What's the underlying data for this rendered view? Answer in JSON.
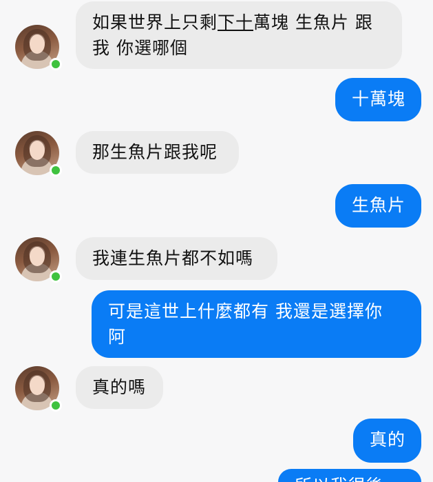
{
  "messages": [
    {
      "side": "in",
      "text_before": "如果世界上只剩",
      "text_underlined": "下十",
      "text_after": "萬塊 生魚片 跟",
      "line2": "我 你選哪個"
    },
    {
      "side": "out",
      "text": "十萬塊"
    },
    {
      "side": "in",
      "text": "那生魚片跟我呢"
    },
    {
      "side": "out",
      "text": "生魚片"
    },
    {
      "side": "in",
      "text": "我連生魚片都不如嗎"
    },
    {
      "side": "out",
      "line1": "可是這世上什麼都有 我還是選擇你",
      "line2": "阿"
    },
    {
      "side": "in",
      "text": "真的嗎"
    },
    {
      "side": "out",
      "text": "真的"
    },
    {
      "side": "out",
      "text": "所以我很後..."
    }
  ],
  "colors": {
    "incoming_bubble": "#ebebeb",
    "outgoing_bubble": "#0a7cf5",
    "online": "#3fc23f",
    "background": "#f7f7f8"
  }
}
